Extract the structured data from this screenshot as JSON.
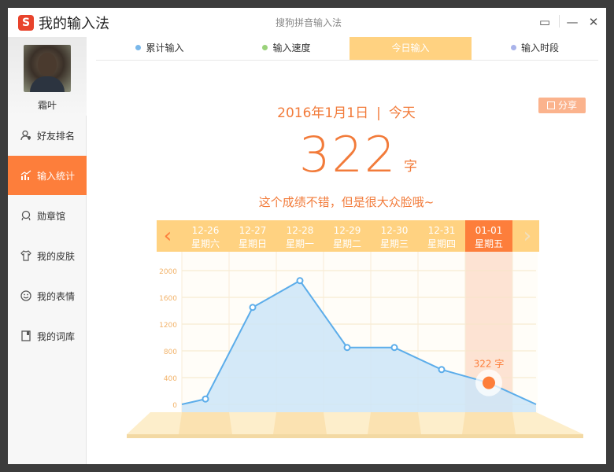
{
  "app": {
    "name": "我的输入法",
    "subtitle": "搜狗拼音输入法",
    "controls": {
      "feedback": "▭",
      "minimize": "—",
      "close": "✕"
    }
  },
  "user": {
    "name": "霜叶"
  },
  "sidebar": {
    "items": [
      {
        "label": "好友排名",
        "icon": "friends-icon"
      },
      {
        "label": "输入统计",
        "icon": "stats-icon",
        "active": true
      },
      {
        "label": "勋章馆",
        "icon": "medal-icon"
      },
      {
        "label": "我的皮肤",
        "icon": "shirt-icon"
      },
      {
        "label": "我的表情",
        "icon": "smiley-icon"
      },
      {
        "label": "我的词库",
        "icon": "dictionary-icon"
      }
    ]
  },
  "tabs": [
    {
      "label": "累计输入",
      "dot": "#7ab8ea"
    },
    {
      "label": "输入速度",
      "dot": "#9ad27a"
    },
    {
      "label": "今日输入",
      "active": true
    },
    {
      "label": "输入时段",
      "dot": "#a9b3ea"
    }
  ],
  "summary": {
    "date": "2016年1月1日",
    "separator": "|",
    "today": "今天",
    "count": "322",
    "unit": "字",
    "comment": "这个成绩不错，但是很大众脸哦~",
    "share_label": "分享"
  },
  "colors": {
    "accent": "#fd7e3b",
    "header_bar": "#ffd281",
    "header_selected": "#fd7e3b",
    "area_fill": "#cde5f8",
    "line": "#5cadea"
  },
  "chart_data": {
    "type": "area",
    "x": [
      "12-26",
      "12-27",
      "12-28",
      "12-29",
      "12-30",
      "12-31",
      "01-01"
    ],
    "weekdays": [
      "星期六",
      "星期日",
      "星期一",
      "星期二",
      "星期三",
      "星期四",
      "星期五"
    ],
    "values": [
      80,
      1450,
      1850,
      850,
      850,
      520,
      322
    ],
    "selected_index": 6,
    "selected_label": "322 字",
    "yticks": [
      0,
      400,
      800,
      1200,
      1600,
      2000
    ],
    "ylim": [
      0,
      2000
    ],
    "grid": true,
    "nav": {
      "prev": "‹",
      "next": "›"
    }
  }
}
